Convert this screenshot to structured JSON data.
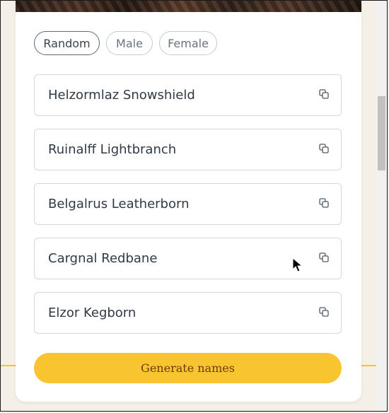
{
  "gender_filter": {
    "options": [
      "Random",
      "Male",
      "Female"
    ],
    "selected": "Random"
  },
  "names": [
    "Helzormlaz Snowshield",
    "Ruinalff Lightbranch",
    "Belgalrus Leatherborn",
    "Cargnal Redbane",
    "Elzor Kegborn"
  ],
  "generate_button_label": "Generate names",
  "colors": {
    "accent": "#f8c530",
    "button_text": "#6b3c12",
    "name_text": "#2f3a45",
    "border": "#d3d8dd"
  },
  "icons": {
    "copy": "copy-icon",
    "cursor": "mouse-pointer-icon"
  }
}
